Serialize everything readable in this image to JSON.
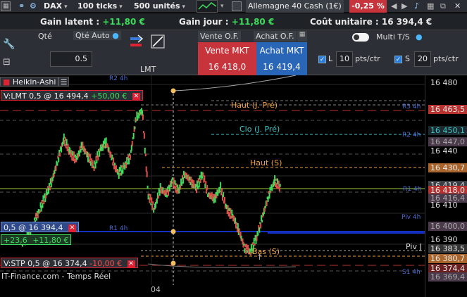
{
  "topbar": {
    "instrument": "DAX",
    "ticks": "100 ticks",
    "units": "500 unités",
    "market": "Allemagne 40 Cash (1€)",
    "change": "-0,25 %"
  },
  "infobar": {
    "latent_label": "Gain latent :",
    "latent_value": "+11,80 €",
    "day_label": "Gain jour :",
    "day_value": "+11,80 €",
    "cost_label": "Coût unitaire :",
    "cost_value": "16 394,4 €"
  },
  "panel": {
    "qty_label": "Qté",
    "qty_auto_label": "Qté Auto",
    "qty_value": "0.5",
    "lmt_label": "LMT",
    "tab_sell": "Vente O.F.",
    "tab_buy": "Achat O.F.",
    "sell_label": "Vente MKT",
    "sell_price": "16 418,0",
    "buy_label": "Achat MKT",
    "buy_price": "16 419,4",
    "multi_label": "Multi T/S",
    "l_label": "L",
    "l_value": "10",
    "s_label": "S",
    "s_value": "20",
    "pts_label": "pts/ctr"
  },
  "chart": {
    "type_label": "Heikin-Ashi",
    "date_label": "04",
    "source_label": "IT-Finance.com - Temps Réel",
    "order_lmt": {
      "text": "V:LMT 0,5 @ 16 494,4",
      "gain": "+50,00 €"
    },
    "position": {
      "text": "0,5 @ 16 394,4",
      "pts": "+23,6",
      "gain": "+11,80 €"
    },
    "order_stp": {
      "text": "V:STP 0,5 @ 16 374,4",
      "loss": "-10,00 €"
    },
    "levels": {
      "haut_pre": "Haut (J. Pré)",
      "clo_pre": "Clo (J. Pré)",
      "haut_s": "Haut (S)",
      "bas_s": "Bas (S)",
      "piv_j": "Piv J",
      "r3_4h": "R3 4h",
      "r2_4h": "R2 4h",
      "r1_4h": "R1 4h",
      "piv_4h": "Piv 4h",
      "s1_4h": "S1 4h",
      "r1_4h_left": "R1 4h",
      "r2_4h_top": "R2 4h"
    },
    "axis_labels": [
      "16 480",
      "16 463,5",
      "16 450,1",
      "16 447,0",
      "16 440",
      "16 430,7",
      "16 419,4",
      "16 418,0",
      "16 416,4",
      "16 410",
      "16 400,0",
      "16 390",
      "16 383,5",
      "16 380,7",
      "16 374,4",
      "16 369,4"
    ]
  },
  "colors": {
    "sell": "#c8343b",
    "buy": "#2a66b8",
    "green": "#3ddc5a",
    "orange": "#f0a040",
    "teal": "#3cc8c8"
  }
}
